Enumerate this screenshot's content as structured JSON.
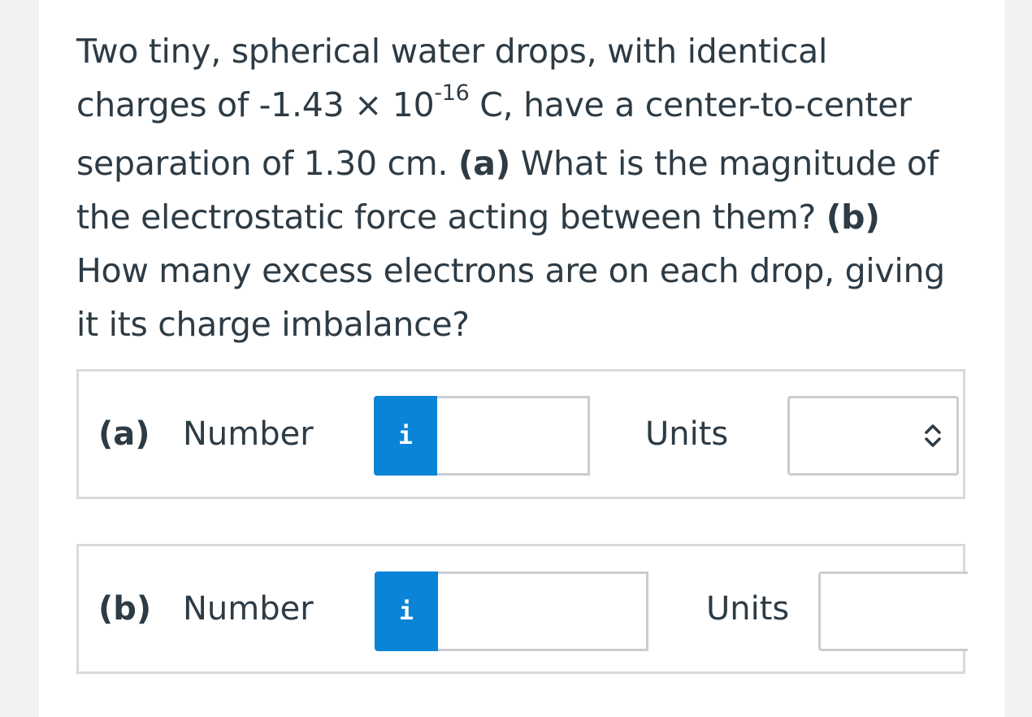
{
  "question": {
    "line1": "Two tiny, spherical water drops, with identical",
    "line2_pre": "charges of -1.43 × 10",
    "line2_exp": "-16",
    "line2_post": " C, have a center-to-center",
    "line3_pre": "separation of 1.30 cm. ",
    "line3_bold": "(a)",
    "line3_post": " What is the magnitude of",
    "line4_pre": "the electrostatic force acting between them? ",
    "line4_bold": "(b)",
    "line5": "How many excess electrons are on each drop, giving",
    "line6": "it its charge imbalance?"
  },
  "parts": [
    {
      "letter": "(a)",
      "number_label": "Number",
      "info_icon": "i",
      "number_value": "",
      "units_label": "Units",
      "units_value": "",
      "icon": "chevron-up-down-icon"
    },
    {
      "letter": "(b)",
      "number_label": "Number",
      "info_icon": "i",
      "number_value": "",
      "units_label": "Units",
      "units_value": ""
    }
  ]
}
